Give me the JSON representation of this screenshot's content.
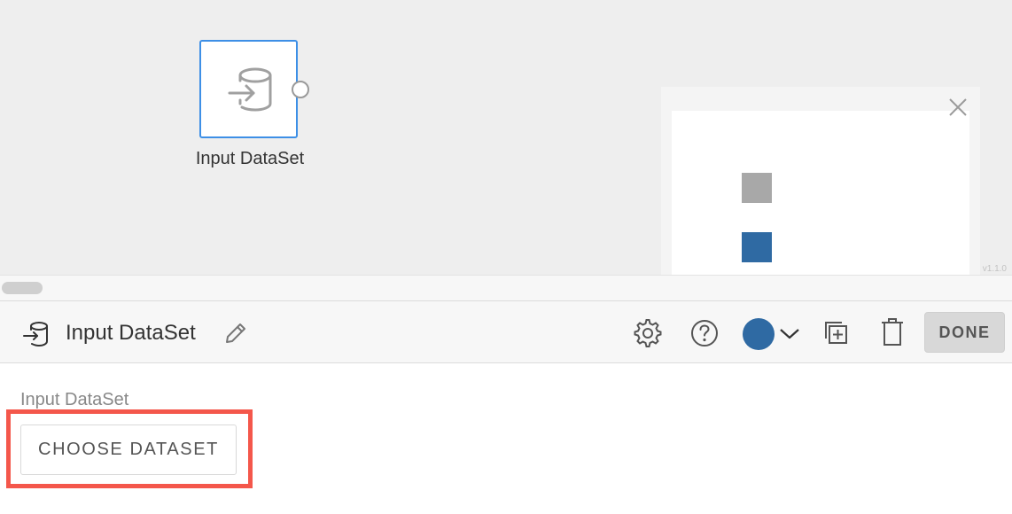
{
  "canvas": {
    "node": {
      "label": "Input DataSet",
      "icon": "dataset-input-icon"
    },
    "minimap": {
      "close_icon": "close-icon"
    },
    "version": "v1.1.0"
  },
  "toolbar": {
    "node_icon": "dataset-input-icon",
    "title": "Input DataSet",
    "edit_icon": "pencil-icon",
    "settings_icon": "gear-icon",
    "help_icon": "help-icon",
    "color": "#2f6aa3",
    "duplicate_icon": "duplicate-icon",
    "delete_icon": "trash-icon",
    "done_label": "DONE"
  },
  "panel": {
    "section_label": "Input DataSet",
    "choose_label": "CHOOSE DATASET"
  },
  "colors": {
    "accent": "#3d8fe6",
    "node_color": "#2f6aa3",
    "highlight": "#f4574b",
    "minimap_gray_node": "#a8a8a8"
  }
}
